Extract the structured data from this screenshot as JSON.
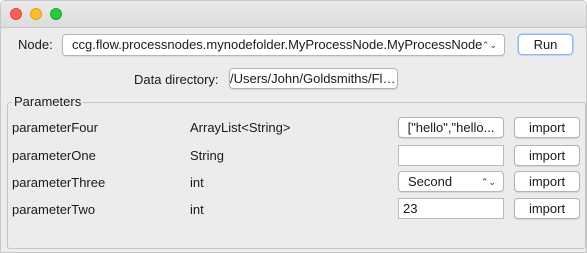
{
  "node": {
    "label": "Node:",
    "selected": "ccg.flow.processnodes.mynodefolder.MyProcessNode.MyProcessNode",
    "arrows": "⌃⌄",
    "run_label": "Run"
  },
  "data_directory": {
    "label": "Data directory:",
    "path": "/Users/John/Goldsmiths/FloWrDev"
  },
  "parameters": {
    "title": "Parameters",
    "import_label": "import",
    "rows": [
      {
        "name": "parameterFour",
        "type": "ArrayList<String>",
        "value": "[\"hello\",\"hello..."
      },
      {
        "name": "parameterOne",
        "type": "String",
        "value": ""
      },
      {
        "name": "parameterThree",
        "type": "int",
        "value": "Second"
      },
      {
        "name": "parameterTwo",
        "type": "int",
        "value": "23"
      }
    ]
  },
  "colors": {
    "window_bg": "#ececec",
    "close": "#fd5f57",
    "minimize": "#febc2e",
    "maximize": "#28c840",
    "default_button_ring": "#8fb7ea"
  }
}
